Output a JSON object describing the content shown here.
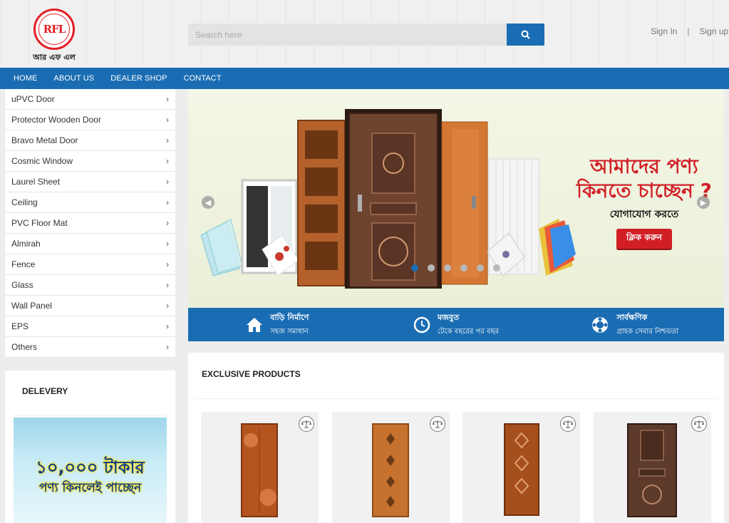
{
  "brand": {
    "logo_text": "RFL",
    "logo_sub": "আর এফ এল"
  },
  "search": {
    "placeholder": "Search here"
  },
  "auth": {
    "sign_in": "Sign In",
    "separator": "|",
    "sign_up": "Sign up"
  },
  "nav": {
    "items": [
      "HOME",
      "ABOUT US",
      "DEALER SHOP",
      "CONTACT"
    ]
  },
  "categories": [
    "uPVC Door",
    "Protector Wooden Door",
    "Bravo Metal Door",
    "Cosmic Window",
    "Laurel Sheet",
    "Ceiling",
    "PVC Floor Mat",
    "Almirah",
    "Fence",
    "Glass",
    "Wall Panel",
    "EPS",
    "Others"
  ],
  "delivery": {
    "title": "DELEVERY",
    "promo_line1": "১০,০০০ টাকার",
    "promo_line2": "পণ্য কিনলেই পাচ্ছেন"
  },
  "slider": {
    "headline_line1": "আমাদের পণ্য",
    "headline_line2": "কিনতে চাচ্ছেন ?",
    "subline": "যোগাযোগ করতে",
    "cta": "ক্লিক করুন",
    "slide_count": 6,
    "active_slide": 1
  },
  "features": [
    {
      "icon": "home-icon",
      "title": "বাড়ি নির্মাণে",
      "subtitle": "সহজ সমাধান"
    },
    {
      "icon": "clock-icon",
      "title": "মজবুত",
      "subtitle": "টেকে বছরের পর বছর"
    },
    {
      "icon": "support-icon",
      "title": "সার্বক্ষণিক",
      "subtitle": "গ্রাহক সেবার নিশ্চয়তা"
    }
  ],
  "products": {
    "title": "EXCLUSIVE PRODUCTS"
  },
  "colors": {
    "primary": "#1a6db3",
    "brand_red": "#e31e24",
    "banner_red": "#d21f26"
  }
}
